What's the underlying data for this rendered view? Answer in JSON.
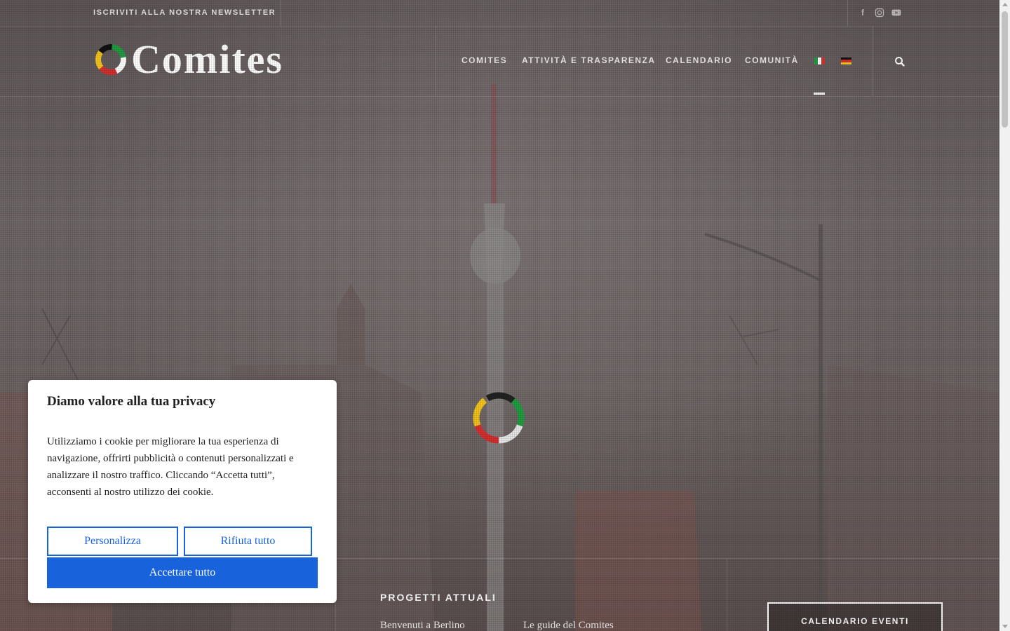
{
  "topbar": {
    "newsletter": "ISCRIVITI ALLA NOSTRA NEWSLETTER",
    "social": [
      "facebook-icon",
      "instagram-icon",
      "youtube-icon"
    ]
  },
  "brand": {
    "name": "Comites"
  },
  "nav": {
    "items": [
      "COMITES",
      "ATTIVITÀ E TRASPARENZA",
      "CALENDARIO",
      "COMUNITÀ"
    ],
    "languages": [
      "it",
      "de"
    ],
    "active_language": "it"
  },
  "hero": {
    "projects_title": "PROGETTI ATTUALI",
    "projects": [
      "Benvenuti a Berlino",
      "Le guide del Comites"
    ],
    "calendar_button": "CALENDARIO EVENTI"
  },
  "cookie": {
    "title": "Diamo valore alla tua privacy",
    "text": "Utilizziamo i cookie per migliorare la tua esperienza di navigazione, offrirti pubblicità o contenuti personalizzati e analizzare il nostro traffico. Cliccando “Accetta tutti”, acconsenti al nostro utilizzo dei cookie.",
    "customize": "Personalizza",
    "reject": "Rifiuta tutto",
    "accept": "Accettare tutto"
  },
  "colors": {
    "accent": "#1863dc",
    "ring": [
      "#1f9d3f",
      "#ffffff",
      "#d62f2f",
      "#f2c31b",
      "#111111"
    ]
  }
}
